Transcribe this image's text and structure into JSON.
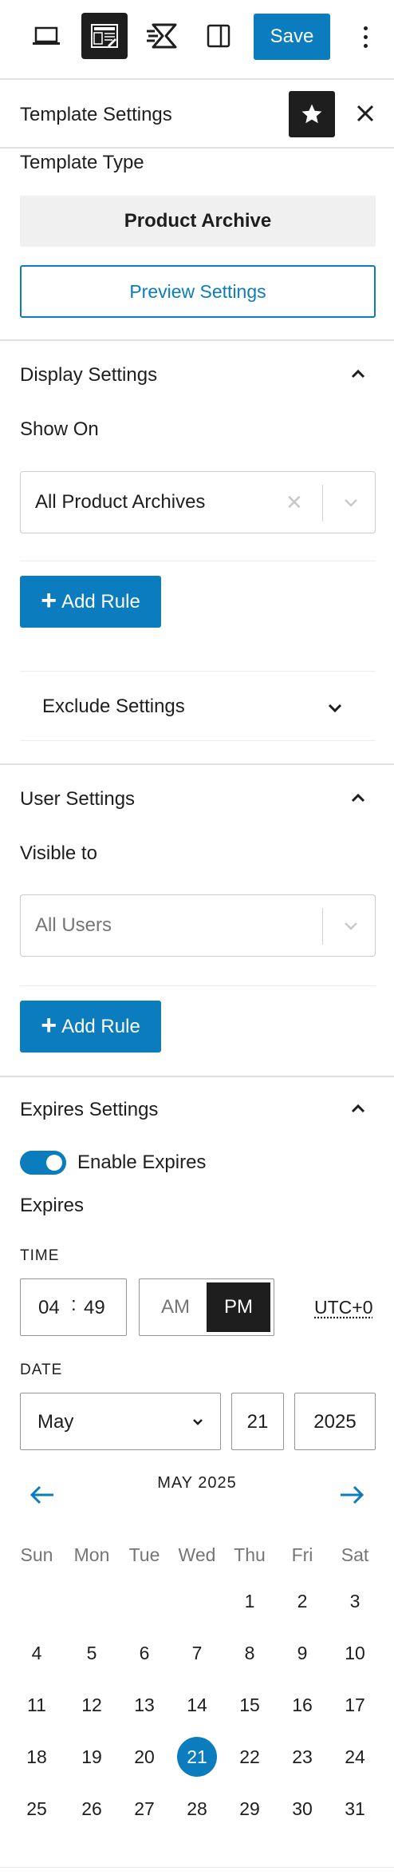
{
  "toolbar": {
    "save_label": "Save",
    "buttons": [
      "desktop-preview-icon",
      "template-settings-icon",
      "speed-lines-icon",
      "sidebar-toggle-icon"
    ]
  },
  "panel": {
    "title": "Template Settings"
  },
  "template_type": {
    "label": "Template Type",
    "value": "Product Archive",
    "preview_button": "Preview Settings"
  },
  "display_settings": {
    "title": "Display Settings",
    "show_on_label": "Show On",
    "show_on_value": "All Product Archives",
    "clear_symbol": "✕",
    "add_rule_label": "Add Rule",
    "add_rule_plus": "+",
    "exclude_title": "Exclude Settings"
  },
  "user_settings": {
    "title": "User Settings",
    "visible_to_label": "Visible to",
    "visible_to_placeholder": "All Users",
    "add_rule_label": "Add Rule",
    "add_rule_plus": "+"
  },
  "expires_settings": {
    "title": "Expires Settings",
    "toggle_label": "Enable Expires",
    "toggle_on": true,
    "expires_label": "Expires",
    "time_label": "TIME",
    "hour": "04",
    "time_separator": ":",
    "minute": "49",
    "am": "AM",
    "pm": "PM",
    "period_selected": "PM",
    "timezone": "UTC+0",
    "date_label": "DATE",
    "month": "May",
    "day": "21",
    "year": "2025"
  },
  "calendar": {
    "heading": "MAY 2025",
    "weekdays": [
      "Sun",
      "Mon",
      "Tue",
      "Wed",
      "Thu",
      "Fri",
      "Sat"
    ],
    "first_weekday_index": 4,
    "days_in_month": 31,
    "selected_day": 21
  },
  "colors": {
    "accent": "#0b7cbd",
    "dark": "#1e1e1e",
    "border": "#e0e0e0"
  }
}
